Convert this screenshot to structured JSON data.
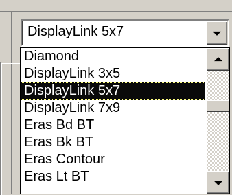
{
  "combo": {
    "selected_value": "DisplayLink 5x7"
  },
  "dropdown": {
    "items": [
      {
        "label": "Diamond",
        "selected": false
      },
      {
        "label": "DisplayLink 3x5",
        "selected": false
      },
      {
        "label": "DisplayLink 5x7",
        "selected": true
      },
      {
        "label": "DisplayLink 7x9",
        "selected": false
      },
      {
        "label": "Eras Bd BT",
        "selected": false
      },
      {
        "label": "Eras Bk BT",
        "selected": false
      },
      {
        "label": "Eras Contour",
        "selected": false
      },
      {
        "label": "Eras Lt BT",
        "selected": false
      }
    ]
  },
  "icons": {
    "dropdown_arrow": "chevron-down-icon",
    "scroll_up": "arrow-up-icon",
    "scroll_down": "arrow-down-icon"
  },
  "colors": {
    "face": "#d4d0c8",
    "selection_bg": "#0a0a0a",
    "selection_text": "#ffffff",
    "field_bg": "#ffffff"
  }
}
